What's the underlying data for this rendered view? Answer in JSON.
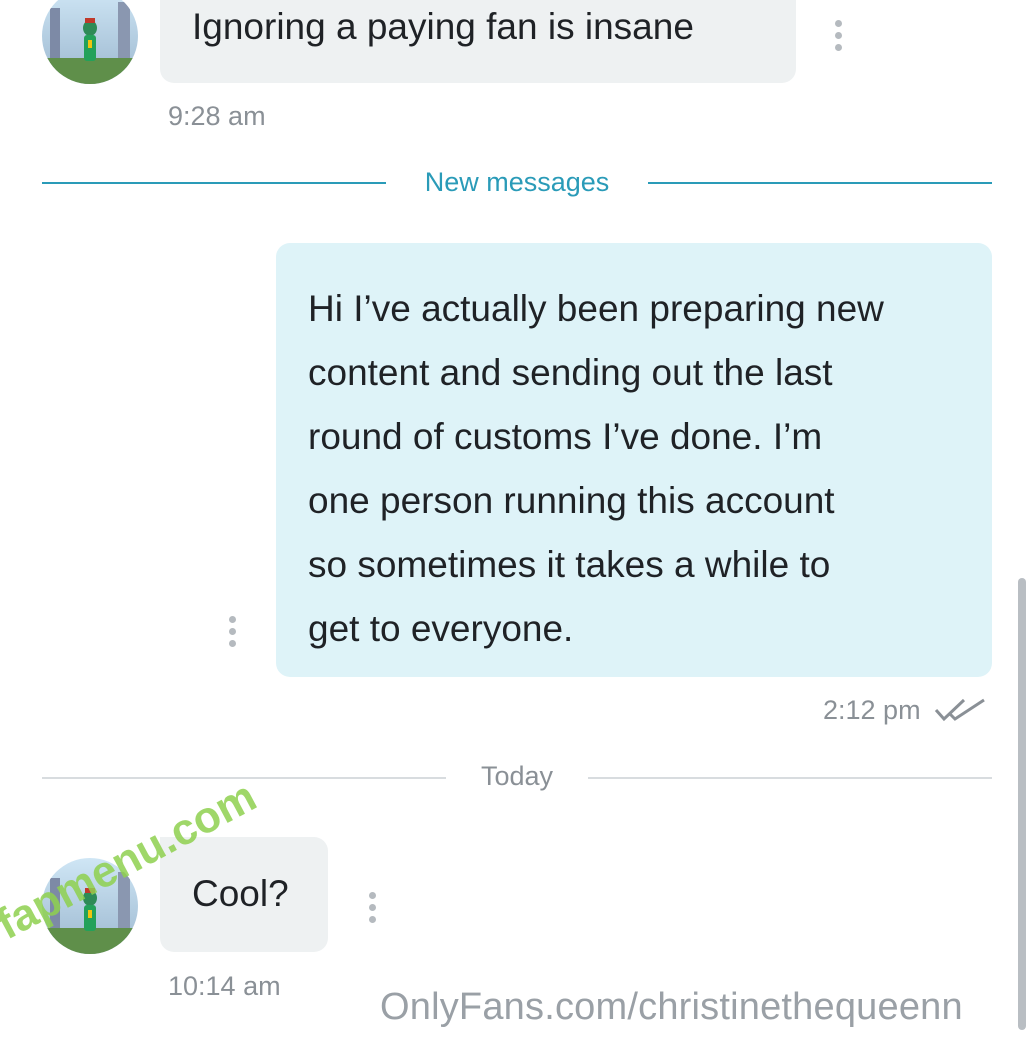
{
  "messages": [
    {
      "direction": "incoming",
      "text": "Ignoring a paying fan is insane",
      "time": "9:28 am"
    },
    {
      "direction": "outgoing",
      "lines": [
        "Hi I’ve actually been preparing new",
        "content and sending out the last",
        "round of customs I’ve done. I’m",
        "one person running this account",
        "so sometimes it takes a while to",
        "get to everyone."
      ],
      "time": "2:12 pm",
      "status": "read-double-check"
    },
    {
      "direction": "incoming",
      "text": "Cool?",
      "time": "10:14 am"
    }
  ],
  "dividers": {
    "new_messages": "New messages",
    "today": "Today"
  },
  "watermarks": {
    "url": "OnlyFans.com/christinethequeenn",
    "diagonal": "fapmenu.com"
  },
  "colors": {
    "accent": "#2a9bb8",
    "incoming_bubble": "#eef1f2",
    "outgoing_bubble": "#def3f8",
    "muted_text": "#8a9096",
    "watermark_green": "#8fd14f"
  },
  "icons": {
    "avatar": "avatar-icon",
    "more": "kebab-menu-icon",
    "read_status": "double-check-icon"
  }
}
